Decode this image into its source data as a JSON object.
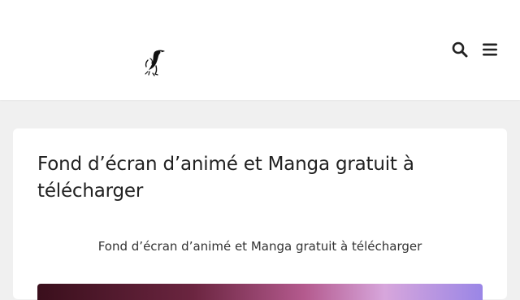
{
  "header": {
    "logo_icon": "penguin-logo-icon",
    "search_icon": "search-icon",
    "menu_icon": "hamburger-menu-icon"
  },
  "article": {
    "title": "Fond d’écran d’animé et Manga gratuit à télécharger",
    "subtitle": "Fond d’écran d’animé et Manga gratuit à télécharger"
  },
  "colors": {
    "page_background": "#f0f0f0",
    "card_background": "#ffffff",
    "text": "#222222"
  }
}
